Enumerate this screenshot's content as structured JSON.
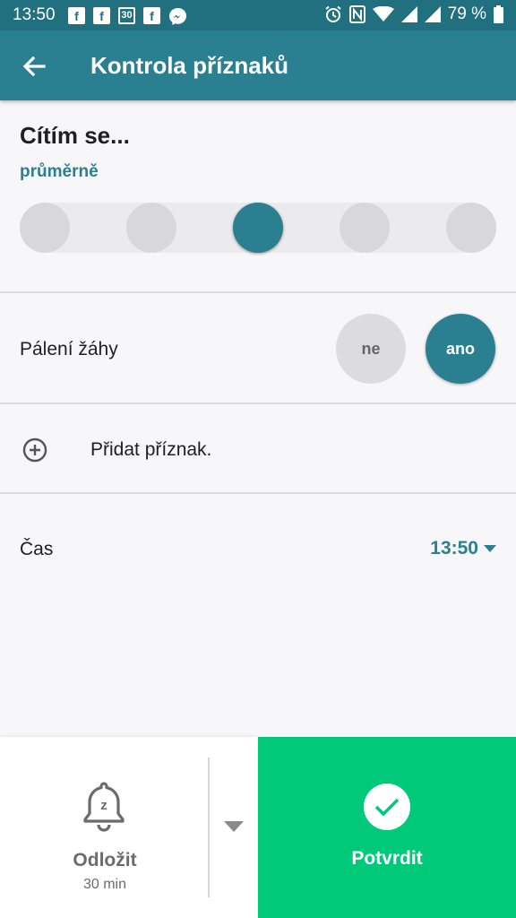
{
  "status_bar": {
    "time": "13:50",
    "battery": "79 %"
  },
  "app_bar": {
    "title": "Kontrola příznaků"
  },
  "feeling": {
    "title": "Cítím se...",
    "value_label": "průměrně",
    "scale_count": 5,
    "selected_index": 2
  },
  "symptom": {
    "label": "Pálení žáhy",
    "no_label": "ne",
    "yes_label": "ano",
    "selected": "ano"
  },
  "add_symptom": {
    "label": "Přidat příznak."
  },
  "time_row": {
    "label": "Čas",
    "value": "13:50"
  },
  "bottom": {
    "snooze_label": "Odložit",
    "snooze_duration": "30 min",
    "confirm_label": "Potvrdit"
  },
  "colors": {
    "primary": "#2a7f91",
    "status_bar": "#21707f",
    "confirm": "#00c979"
  }
}
